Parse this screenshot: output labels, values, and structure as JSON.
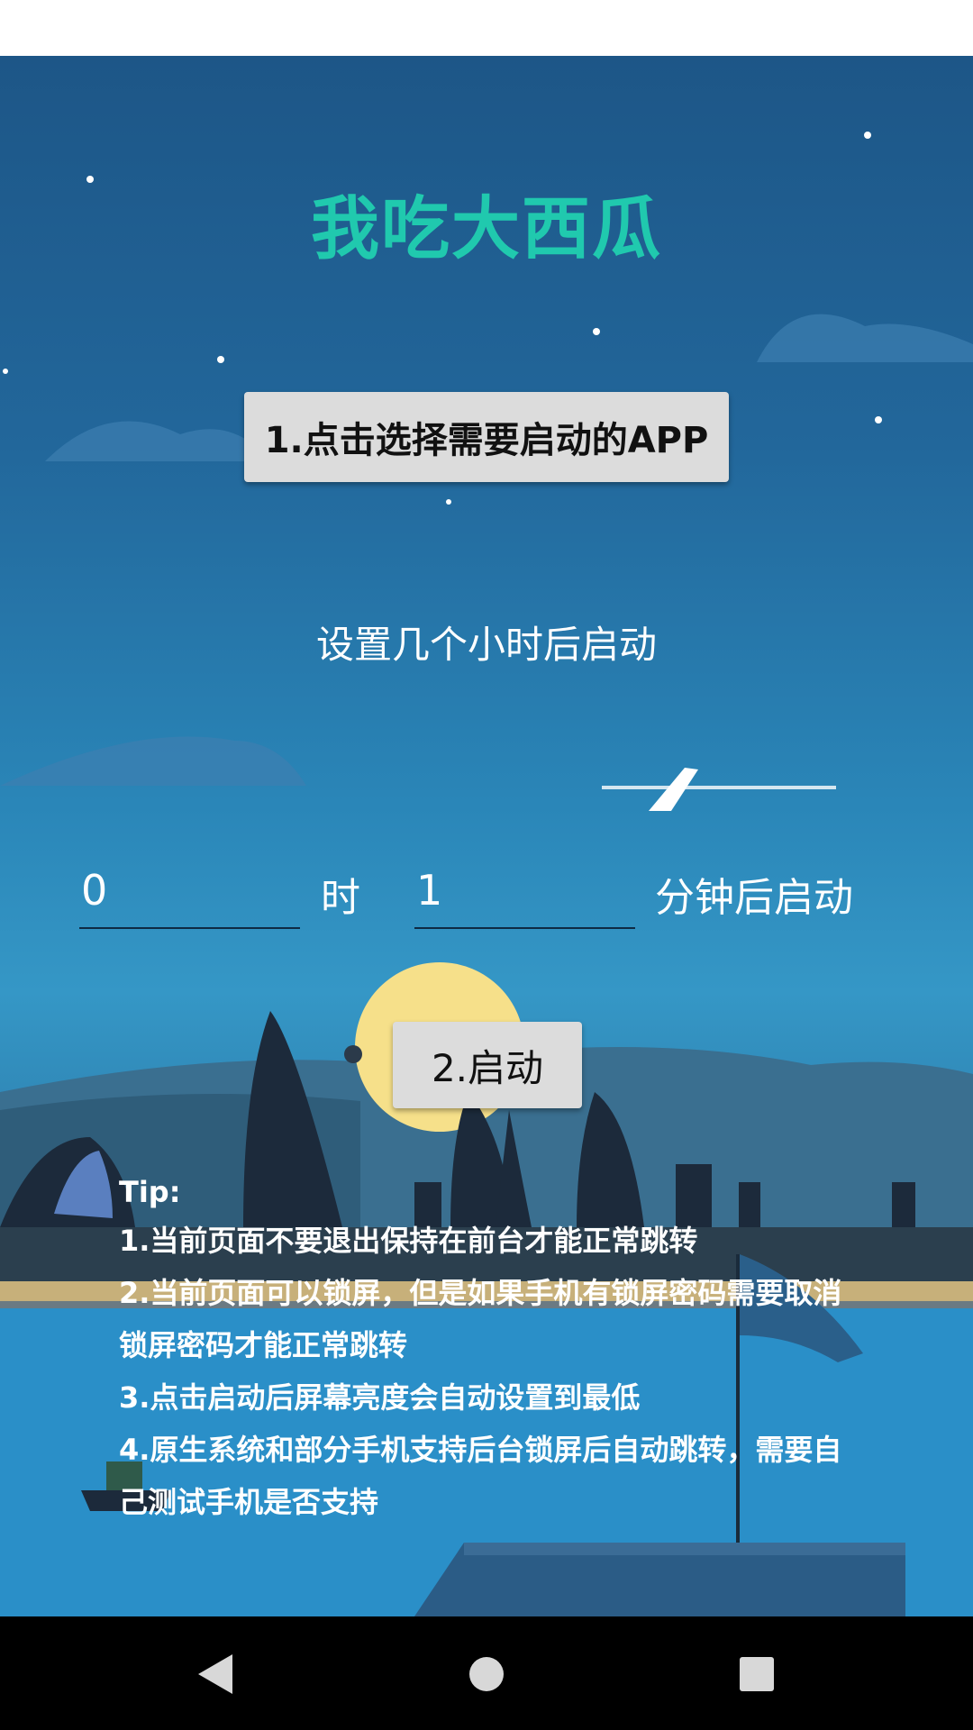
{
  "app": {
    "title": "我吃大西瓜",
    "select_app_button": "1.点击选择需要启动的APP",
    "delay_prompt": "设置几个小时后启动",
    "hours_value": "0",
    "hours_unit": "时",
    "minutes_value": "1",
    "minutes_unit": "分钟后启动",
    "start_button": "2.启动"
  },
  "tips": {
    "heading": "Tip:",
    "items": [
      "1.当前页面不要退出保持在前台才能正常跳转",
      "2.当前页面可以锁屏，但是如果手机有锁屏密码需要取消锁屏密码才能正常跳转",
      "3.点击启动后屏幕亮度会自动设置到最低",
      "4.原生系统和部分手机支持后台锁屏后自动跳转，需要自己测试手机是否支持"
    ]
  },
  "nav": {
    "back_icon": "triangle-back-icon",
    "home_icon": "circle-home-icon",
    "recent_icon": "square-recents-icon"
  },
  "colors": {
    "title": "#20c9ae",
    "button_bg": "#dcdcdc",
    "sky_top": "#1d5687",
    "nav_bar": "#000000"
  }
}
